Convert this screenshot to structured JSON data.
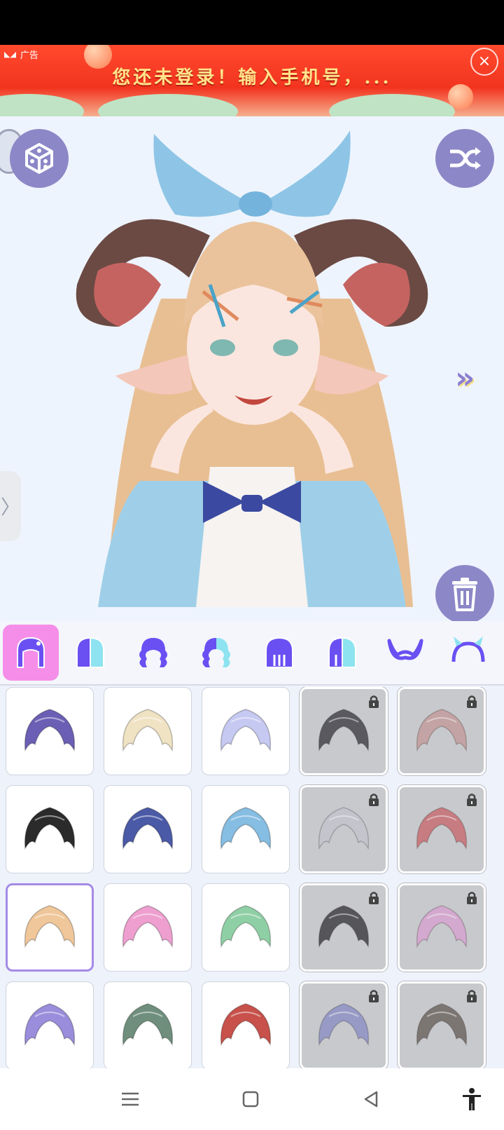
{
  "ad": {
    "tag": "广告",
    "text": "您还未登录！输入手机号，...",
    "close": "×"
  },
  "canvas": {
    "left_tab_glyph": "〉",
    "next_glyph": "»"
  },
  "categories": [
    {
      "id": "hair-full",
      "active": true
    },
    {
      "id": "hair-front-half",
      "active": false
    },
    {
      "id": "hair-curly",
      "active": false
    },
    {
      "id": "hair-curly-half",
      "active": false
    },
    {
      "id": "hair-back",
      "active": false
    },
    {
      "id": "hair-back-half",
      "active": false
    },
    {
      "id": "horns",
      "active": false
    },
    {
      "id": "headband",
      "active": false
    }
  ],
  "hair_items": [
    {
      "color": "#6b5fb5",
      "locked": false,
      "selected": false
    },
    {
      "color": "#efe3c4",
      "locked": false,
      "selected": false
    },
    {
      "color": "#c6c9f1",
      "locked": false,
      "selected": false
    },
    {
      "color": "#3e3e44",
      "locked": true,
      "selected": false
    },
    {
      "color": "#c39a9a",
      "locked": true,
      "selected": false
    },
    {
      "color": "#2b2b2b",
      "locked": false,
      "selected": false
    },
    {
      "color": "#4b5aa6",
      "locked": false,
      "selected": false
    },
    {
      "color": "#86bde2",
      "locked": false,
      "selected": false
    },
    {
      "color": "#c4c4cc",
      "locked": true,
      "selected": false
    },
    {
      "color": "#c76a6f",
      "locked": true,
      "selected": false
    },
    {
      "color": "#f0c79a",
      "locked": false,
      "selected": true
    },
    {
      "color": "#ee9fcf",
      "locked": false,
      "selected": false
    },
    {
      "color": "#8fcfa5",
      "locked": false,
      "selected": false
    },
    {
      "color": "#3a3a3e",
      "locked": true,
      "selected": false
    },
    {
      "color": "#d8a2d0",
      "locked": true,
      "selected": false
    },
    {
      "color": "#9a8ddb",
      "locked": false,
      "selected": false
    },
    {
      "color": "#6f8f7c",
      "locked": false,
      "selected": false
    },
    {
      "color": "#c8514b",
      "locked": false,
      "selected": false
    },
    {
      "color": "#8b8fc4",
      "locked": true,
      "selected": false
    },
    {
      "color": "#6a625d",
      "locked": true,
      "selected": false
    }
  ],
  "colors": {
    "accent": "#8c87c7",
    "active_tab": "#f58ee8",
    "icon": "#6a4ff2"
  }
}
